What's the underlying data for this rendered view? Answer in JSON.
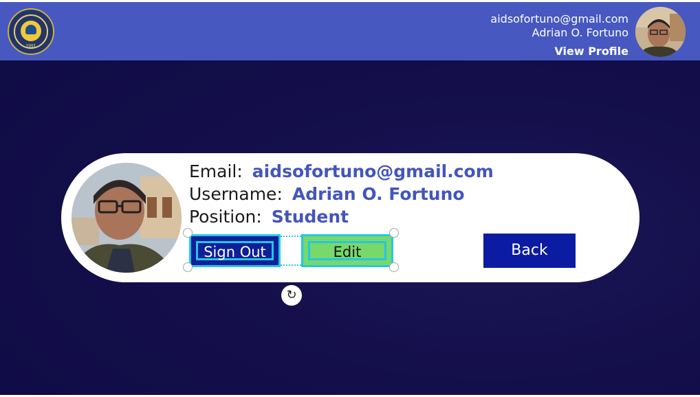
{
  "header": {
    "email": "aidsofortuno@gmail.com",
    "name": "Adrian O. Fortuno",
    "view_profile_label": "View Profile",
    "logo_year": "1991"
  },
  "profile": {
    "email_label": "Email:",
    "email_value": "aidsofortuno@gmail.com",
    "username_label": "Username:",
    "username_value": "Adrian O. Fortuno",
    "position_label": "Position:",
    "position_value": "Student"
  },
  "buttons": {
    "sign_out": "Sign Out",
    "edit": "Edit",
    "back": "Back"
  },
  "icons": {
    "rotate": "rotate-icon"
  },
  "colors": {
    "header_bg": "#4758c0",
    "accent_text": "#4455bb",
    "selection": "#22c7e6",
    "back_button": "#0b1ca3",
    "edit_button": "#79d86a"
  }
}
